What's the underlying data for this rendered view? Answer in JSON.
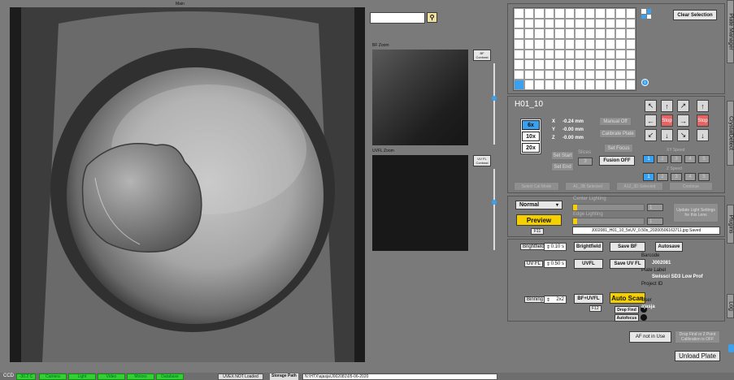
{
  "main_label": "Main",
  "bf_zoom_label": "BF Zoom",
  "uvfl_zoom_label": "UVFL Zoom",
  "bf_contrast_label": "BF Contrast",
  "uvfl_contrast_label": "UV FL Contrast",
  "well_name": "H01_10",
  "clear_selection": "Clear Selection",
  "plate_grid": {
    "rows": 8,
    "cols": 12,
    "selected_row": 7,
    "selected_col": 0
  },
  "magnification": {
    "options": [
      "6x",
      "10x",
      "20x"
    ],
    "selected": "6x"
  },
  "coords": [
    {
      "axis": "X",
      "value": "-0.24 mm"
    },
    {
      "axis": "Y",
      "value": "-0.00 mm"
    },
    {
      "axis": "Z",
      "value": "-0.00 mm"
    }
  ],
  "buttons": {
    "manual_off": "Manual Off",
    "calibrate_plate": "Calibrate Plate",
    "set_focus": "Set Focus",
    "fusion_off": "Fusion OFF",
    "set_start": "Set Start",
    "set_end": "Set End",
    "select_cal_mode": "Select Cal Mode",
    "a1_3b_selected": "A1_3B Selected",
    "a12_3d_selected": "A12_3D Selected",
    "continue": "Continue",
    "update_light": "Update Light Settings for this Lens",
    "preview": "Preview",
    "f11": "F11",
    "brightfield": "Brightfield",
    "save_bf": "Save BF",
    "autosave": "Autosave",
    "uvfl": "UVFL",
    "save_uvfl": "Save UV FL",
    "bf_uvfl": "BF+UVFL",
    "f12": "F12",
    "auto_scan": "Auto Scan",
    "drop_find": "Drop Find",
    "autofocus": "Autofocus",
    "af_not_in_use": "AF not in Use",
    "drop_find_cal": "Drop Find or 2 Point Calibration is OFF",
    "unload_plate": "Unload Plate"
  },
  "slices_label": "Slices",
  "slices_value": "3",
  "stop_label": "Stop",
  "xy_speed_label": "XY Speed",
  "z_speed_label": "Z Speed",
  "speed_options": [
    "1",
    "2",
    "3",
    "4",
    "5"
  ],
  "lighting_mode": "Normal",
  "center_lighting_label": "Center Lighting",
  "edge_lighting_label": "Edge Lighting",
  "center_value": "1",
  "edge_value": "1",
  "saved_filename": "J002081_H01_10_5xUV_0.50s_20200506163711.jpg Saved",
  "brightfield_label": "Brightfield",
  "brightfield_exposure": "0.10 s",
  "uvfl_label": "UV FL",
  "uvfl_exposure": "0.50 s",
  "binning_label": "Binning",
  "binning_value": "2x2",
  "barcode_label": "Barcode",
  "barcode_value": "J002081",
  "plate_label_label": "Plate Label",
  "plate_label_value": "Swissci SD3 Low Prof",
  "project_id_label": "Project ID",
  "user_label": "User",
  "user_value": "ajasja",
  "side_tabs": [
    "Plate Manager",
    "CrystalDetect",
    "Plugins",
    "Log"
  ],
  "status_bar": {
    "ccd": "CCD",
    "temp": "-30.2 C",
    "green_items": [
      "Camera",
      "Light",
      "Video",
      "Motors",
      "Database"
    ],
    "uvex": "UVEX NOT Loaded",
    "storage_label": "Storage Path",
    "storage_path": "N:\\HTX\\ajasja\\J002081\\05-06-2020"
  },
  "colors": {
    "accent_blue": "#3aa0f0",
    "stop_red": "#e46464",
    "yellow": "#f5d000",
    "green": "#2fd22f"
  }
}
